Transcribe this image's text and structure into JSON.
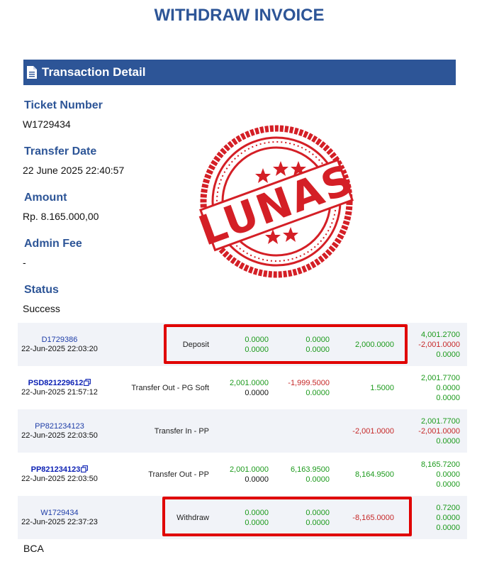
{
  "page": {
    "title": "WITHDRAW INVOICE"
  },
  "section": {
    "title": "Transaction Detail",
    "icon": "document-icon"
  },
  "fields": {
    "ticket_number": {
      "label": "Ticket Number",
      "value": "W1729434"
    },
    "transfer_date": {
      "label": "Transfer Date",
      "value": "22 June 2025 22:40:57"
    },
    "amount": {
      "label": "Amount",
      "value": "Rp. 8.165.000,00"
    },
    "admin_fee": {
      "label": "Admin Fee",
      "value": "-"
    },
    "status": {
      "label": "Status",
      "value": "Success"
    }
  },
  "stamp": {
    "text": "LUNAS",
    "color": "#d41f26"
  },
  "colors": {
    "accent": "#2d5597",
    "positive": "#1c9a1c",
    "negative": "#c62828",
    "highlight": "#e00000"
  },
  "transactions": [
    {
      "ref": "D1729386",
      "datetime": "22-Jun-2025 22:03:20",
      "type": "Deposit",
      "col1": [
        "0.0000",
        "0.0000"
      ],
      "col2": [
        "0.0000",
        "0.0000"
      ],
      "amount": "2,000.0000",
      "balance": [
        "4,001.2700",
        "-2,001.0000",
        "0.0000"
      ]
    },
    {
      "ref": "PSD821229612",
      "datetime": "22-Jun-2025 21:57:12",
      "type": "Transfer Out - PG Soft",
      "col1": [
        "2,001.0000",
        "0.0000"
      ],
      "col2": [
        "-1,999.5000",
        "0.0000"
      ],
      "amount": "1.5000",
      "balance": [
        "2,001.7700",
        "0.0000",
        "0.0000"
      ]
    },
    {
      "ref": "PP821234123",
      "datetime": "22-Jun-2025 22:03:50",
      "type": "Transfer In - PP",
      "amount": "-2,001.0000",
      "balance": [
        "2,001.7700",
        "-2,001.0000",
        "0.0000"
      ]
    },
    {
      "ref": "PP821234123",
      "datetime": "22-Jun-2025 22:03:50",
      "type": "Transfer Out - PP",
      "col1": [
        "2,001.0000",
        "0.0000"
      ],
      "col2": [
        "6,163.9500",
        "0.0000"
      ],
      "amount": "8,164.9500",
      "balance": [
        "8,165.7200",
        "0.0000",
        "0.0000"
      ]
    },
    {
      "ref": "W1729434",
      "datetime": "22-Jun-2025 22:37:23",
      "type": "Withdraw",
      "col1": [
        "0.0000",
        "0.0000"
      ],
      "col2": [
        "0.0000",
        "0.0000"
      ],
      "amount": "-8,165.0000",
      "balance": [
        "0.7200",
        "0.0000",
        "0.0000"
      ]
    }
  ],
  "bank": "BCA"
}
